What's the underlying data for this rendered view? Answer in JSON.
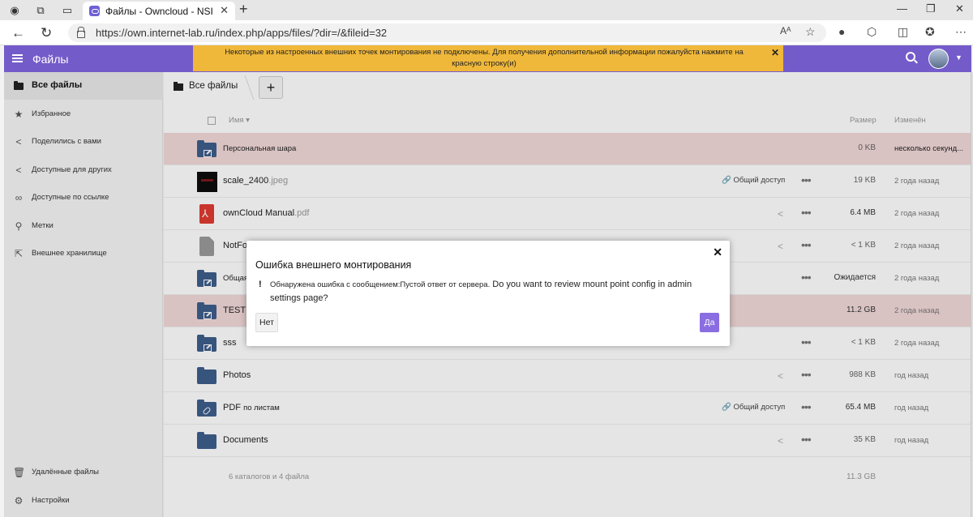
{
  "browser": {
    "tab_title": "Файлы - Owncloud - NSI",
    "url": "https://own.internet-lab.ru/index.php/apps/files/?dir=/&fileid=32",
    "reader_icon": "Aᴬ"
  },
  "header": {
    "app_title": "Файлы",
    "warning": "Некоторые из настроенных внешних точек монтирования не подключены. Для получения дополнительной информации пожалуйста нажмите на красную строку(и)"
  },
  "sidebar": {
    "items": [
      {
        "label": "Все файлы",
        "icon": "folder-icon"
      },
      {
        "label": "Избранное",
        "icon": "star-icon"
      },
      {
        "label": "Поделились с вами",
        "icon": "share-icon"
      },
      {
        "label": "Доступные для других",
        "icon": "share-icon"
      },
      {
        "label": "Доступные по ссылке",
        "icon": "link-icon"
      },
      {
        "label": "Метки",
        "icon": "tag-icon"
      },
      {
        "label": "Внешнее хранилище",
        "icon": "external-icon"
      }
    ],
    "trash_label": "Удалённые файлы",
    "settings_label": "Настройки"
  },
  "main": {
    "breadcrumb": "Все файлы",
    "add_label": "+",
    "columns": {
      "name": "Имя",
      "size": "Размер",
      "modified": "Изменён"
    },
    "share_label": "Общий доступ",
    "rows": [
      {
        "name": "Персональная шара",
        "ext": "",
        "size": "0 KB",
        "modified": "несколько секунд..."
      },
      {
        "name": "scale_2400",
        "ext": ".jpeg",
        "size": "19 KB",
        "modified": "2 года назад"
      },
      {
        "name": "ownCloud Manual",
        "ext": ".pdf",
        "size": "6.4 MB",
        "modified": "2 года назад"
      },
      {
        "name": "NotFo",
        "ext": "",
        "size": "< 1 KB",
        "modified": "2 года назад"
      },
      {
        "name": "Общая",
        "ext": "",
        "size": "Ожидается",
        "modified": "2 года назад"
      },
      {
        "name": "TEST e",
        "ext": "",
        "size": "11.2 GB",
        "modified": "2 года назад"
      },
      {
        "name": "sss",
        "ext": "",
        "size": "< 1 KB",
        "modified": "2 года назад"
      },
      {
        "name": "Photos",
        "ext": "",
        "size": "988 KB",
        "modified": "год назад"
      },
      {
        "name": "PDF",
        "name_suffix": "по листам",
        "ext": "",
        "size": "65.4 MB",
        "modified": "год назад"
      },
      {
        "name": "Documents",
        "ext": "",
        "size": "35 KB",
        "modified": "год назад"
      }
    ],
    "summary": "6 каталогов и 4 файла",
    "summary_size": "11.3 GB"
  },
  "dialog": {
    "title": "Ошибка внешнего монтирования",
    "message_ru": "Обнаружена ошибка с сообщением:Пустой ответ от сервера.",
    "message_en": "Do you want to review mount point config in admin settings page?",
    "no_label": "Нет",
    "yes_label": "Да"
  }
}
